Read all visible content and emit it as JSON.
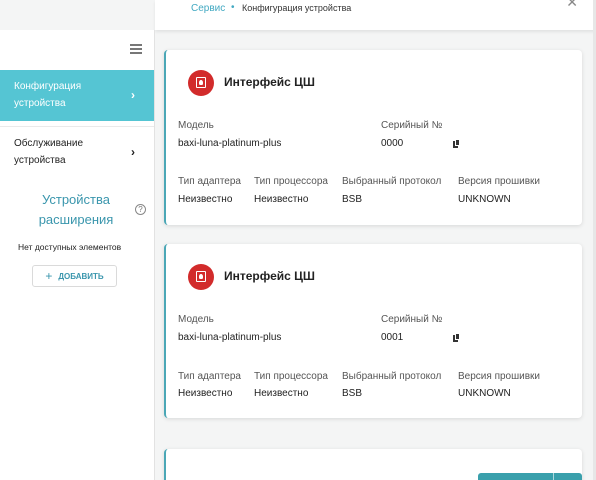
{
  "breadcrumb": {
    "root": "Сервис",
    "separator": "•",
    "current": "Конфигурация устройства"
  },
  "sidebar": {
    "items": [
      {
        "label": "Конфигурация устройства",
        "active": true
      },
      {
        "label": "Обслуживание устройства",
        "active": false
      }
    ],
    "extensions_title": "Устройства расширения",
    "no_items": "Нет доступных элементов",
    "add_label": "ДОБАВИТЬ"
  },
  "labels": {
    "model": "Модель",
    "serial": "Серийный №",
    "adapter_type": "Тип адаптера",
    "processor_type": "Тип процессора",
    "protocol": "Выбранный протокол",
    "firmware": "Версия прошивки"
  },
  "cards": [
    {
      "title": "Интерфейс ЦШ",
      "model": "baxi-luna-platinum-plus",
      "serial": "0000",
      "adapter_type": "Неизвестно",
      "processor_type": "Неизвестно",
      "protocol": "BSB",
      "firmware": "UNKNOWN"
    },
    {
      "title": "Интерфейс ЦШ",
      "model": "baxi-luna-platinum-plus",
      "serial": "0001",
      "adapter_type": "Неизвестно",
      "processor_type": "Неизвестно",
      "protocol": "BSB",
      "firmware": "UNKNOWN"
    }
  ],
  "colors": {
    "accent": "#55c5d3",
    "accent_text": "#3a96ad",
    "device_icon": "#d22b2b"
  }
}
